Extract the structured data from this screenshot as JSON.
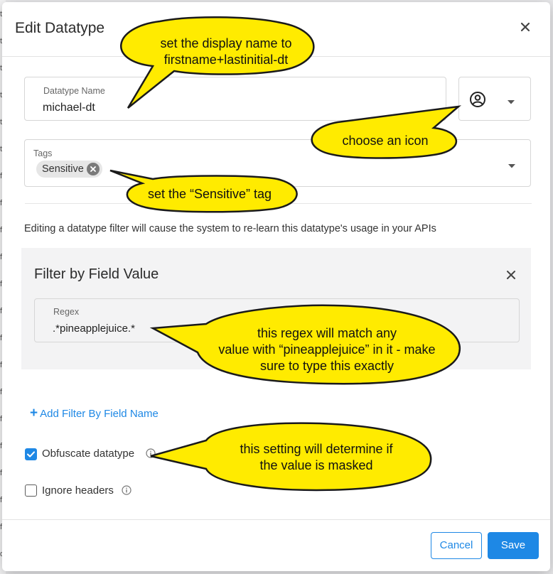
{
  "dialog": {
    "title": "Edit Datatype",
    "name_field": {
      "label": "Datatype Name",
      "value": "michael-dt"
    },
    "icon_select": {
      "selected_icon": "account-circle-icon"
    },
    "tags_field": {
      "label": "Tags",
      "chips": [
        "Sensitive"
      ]
    },
    "notice": "Editing a datatype filter will cause the system to re-learn this datatype's usage in your APIs",
    "filter": {
      "title": "Filter by Field Value",
      "regex_label": "Regex",
      "regex_value": ".*pineapplejuice.*"
    },
    "add_filter_label": "Add Filter By Field Name",
    "obfuscate": {
      "label": "Obfuscate datatype",
      "checked": true
    },
    "ignore_headers": {
      "label": "Ignore headers",
      "checked": false
    },
    "buttons": {
      "cancel": "Cancel",
      "save": "Save"
    }
  },
  "callouts": {
    "display_name": [
      "set the display name to",
      "firstname+lastinitial-dt"
    ],
    "icon": [
      "choose an icon"
    ],
    "tag": [
      "set the “Sensitive” tag"
    ],
    "regex": [
      "this regex will match any",
      "value with “pineapplejuice” in it - make",
      "sure to type this exactly"
    ],
    "obfuscate": [
      "this setting will determine if",
      "the value is masked"
    ]
  },
  "background_marks": [
    "t",
    "t",
    "t",
    "t",
    "t",
    "t",
    "f",
    "f",
    "f",
    "f",
    "f",
    "f",
    "f",
    "f",
    "f",
    "f",
    "f",
    "f",
    "f",
    "f",
    "d"
  ],
  "colors": {
    "accent": "#1e88e5",
    "callout_fill": "#ffeb00",
    "callout_stroke": "#1a1a1a"
  }
}
